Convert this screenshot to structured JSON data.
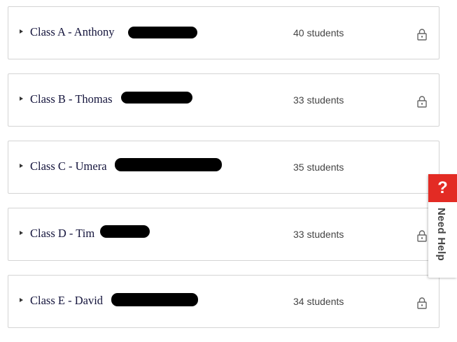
{
  "classes": [
    {
      "name": "Class A - Anthony",
      "students": "40 students",
      "locked": true
    },
    {
      "name": "Class B - Thomas",
      "students": "33 students",
      "locked": true
    },
    {
      "name": "Class C - Umera",
      "students": "35 students",
      "locked": false
    },
    {
      "name": "Class D - Tim",
      "students": "33 students",
      "locked": true
    },
    {
      "name": "Class E - David",
      "students": "34 students",
      "locked": true
    }
  ],
  "help": {
    "icon_symbol": "?",
    "label": "Need Help",
    "accent_color": "#e32b24"
  },
  "icons": {
    "expand": "caret-right-icon",
    "lock": "lock-icon"
  }
}
